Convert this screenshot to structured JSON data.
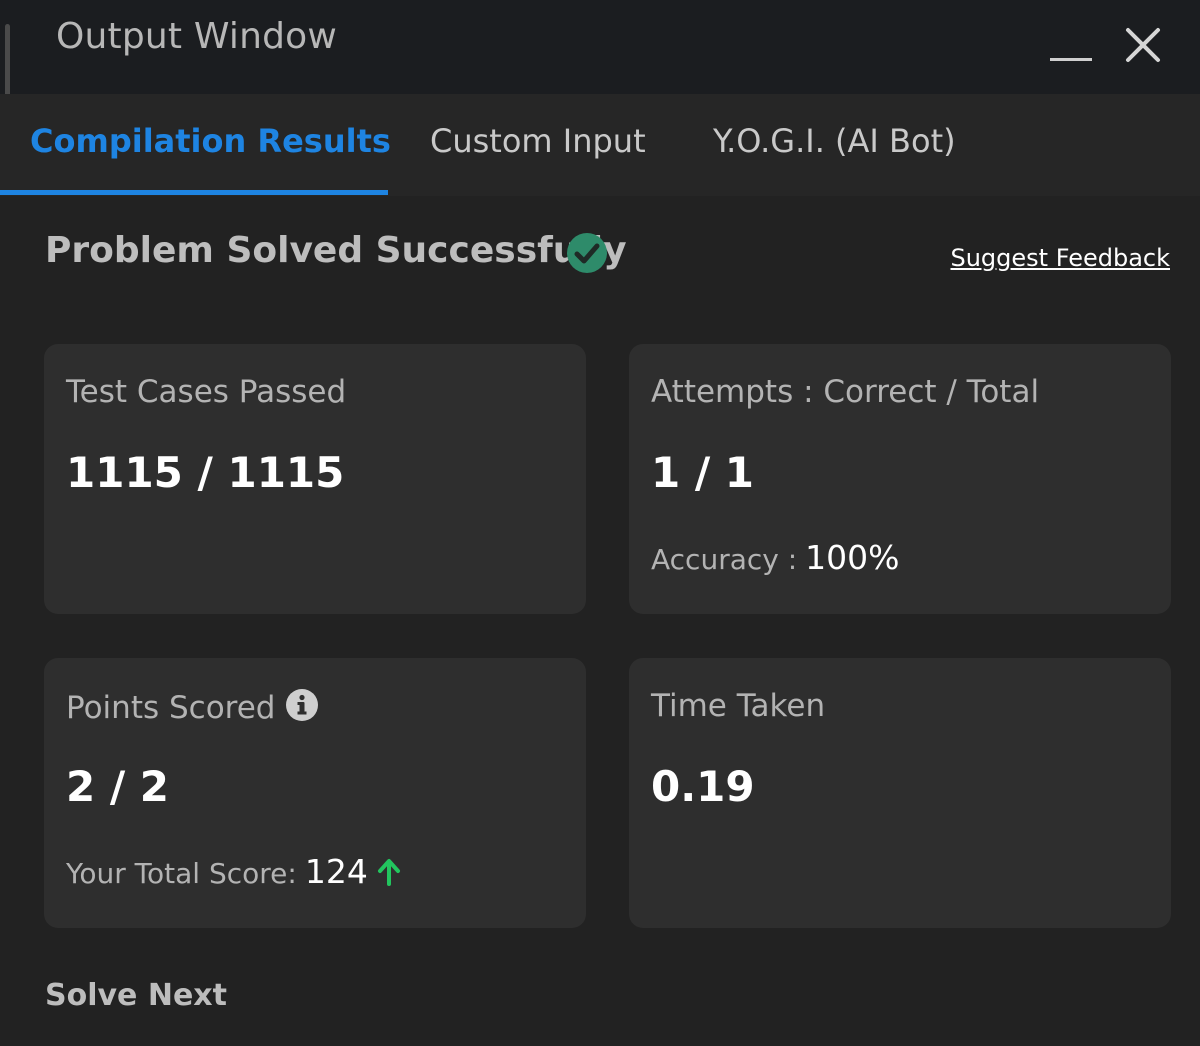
{
  "window": {
    "title": "Output Window"
  },
  "tabs": [
    {
      "label": "Compilation Results",
      "active": true
    },
    {
      "label": "Custom Input",
      "active": false
    },
    {
      "label": "Y.O.G.I. (AI Bot)",
      "active": false
    }
  ],
  "status": {
    "title": "Problem Solved Successfully",
    "icon": "check-circle-icon",
    "icon_color": "#2e8b6a",
    "feedback_link": "Suggest Feedback"
  },
  "cards": {
    "test_cases": {
      "label": "Test Cases Passed",
      "value": "1115 / 1115"
    },
    "attempts": {
      "label": "Attempts : Correct / Total",
      "value": "1 / 1",
      "sub_label": "Accuracy :",
      "sub_value": "100%"
    },
    "points": {
      "label": "Points Scored",
      "info_icon": "info-icon",
      "value": "2 / 2",
      "sub_label": "Your Total Score:",
      "sub_value": "124",
      "trend_icon": "arrow-up-icon",
      "trend_color": "#22c55e"
    },
    "time": {
      "label": "Time Taken",
      "value": "0.19"
    }
  },
  "footer": {
    "solve_next": "Solve Next"
  },
  "colors": {
    "accent": "#1e84e2",
    "background": "#222222",
    "card": "#2e2e2e"
  }
}
